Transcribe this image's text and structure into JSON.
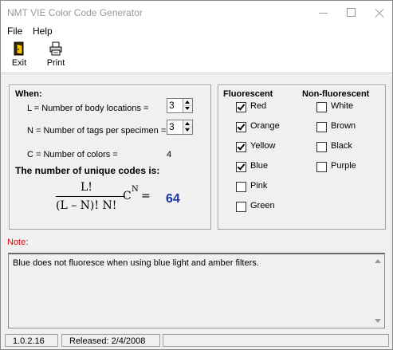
{
  "window": {
    "title": "NMT VIE Color Code Generator"
  },
  "menu": {
    "file": "File",
    "help": "Help"
  },
  "toolbar": {
    "exit_label": "Exit",
    "print_label": "Print",
    "exit_icon": "exit-door-icon",
    "print_icon": "printer-icon"
  },
  "when": {
    "heading": "When:",
    "l_label": "L = Number of body locations =",
    "l_value": "3",
    "n_label": "N = Number of tags per specimen =",
    "n_value": "3",
    "c_label": "C = Number of colors =",
    "c_value": "4",
    "unique_heading": "The number of unique codes is:"
  },
  "formula": {
    "numerator": "L!",
    "denominator": "(L – N)! N!",
    "base": "C",
    "exponent": "N",
    "equals": "=",
    "result": "64",
    "result_color": "#1a32a8"
  },
  "fluorescent": {
    "heading": "Fluorescent",
    "items": [
      {
        "label": "Red",
        "checked": true
      },
      {
        "label": "Orange",
        "checked": true
      },
      {
        "label": "Yellow",
        "checked": true
      },
      {
        "label": "Blue",
        "checked": true
      },
      {
        "label": "Pink",
        "checked": false
      },
      {
        "label": "Green",
        "checked": false
      }
    ]
  },
  "non_fluorescent": {
    "heading": "Non-fluorescent",
    "items": [
      {
        "label": "White",
        "checked": false
      },
      {
        "label": "Brown",
        "checked": false
      },
      {
        "label": "Black",
        "checked": false
      },
      {
        "label": "Purple",
        "checked": false
      }
    ]
  },
  "note": {
    "label": "Note:",
    "text": "Blue does not fluoresce when using blue light and amber filters.",
    "label_color": "#e00000"
  },
  "status": {
    "version": "1.0.2.16",
    "released": "Released: 2/4/2008"
  }
}
